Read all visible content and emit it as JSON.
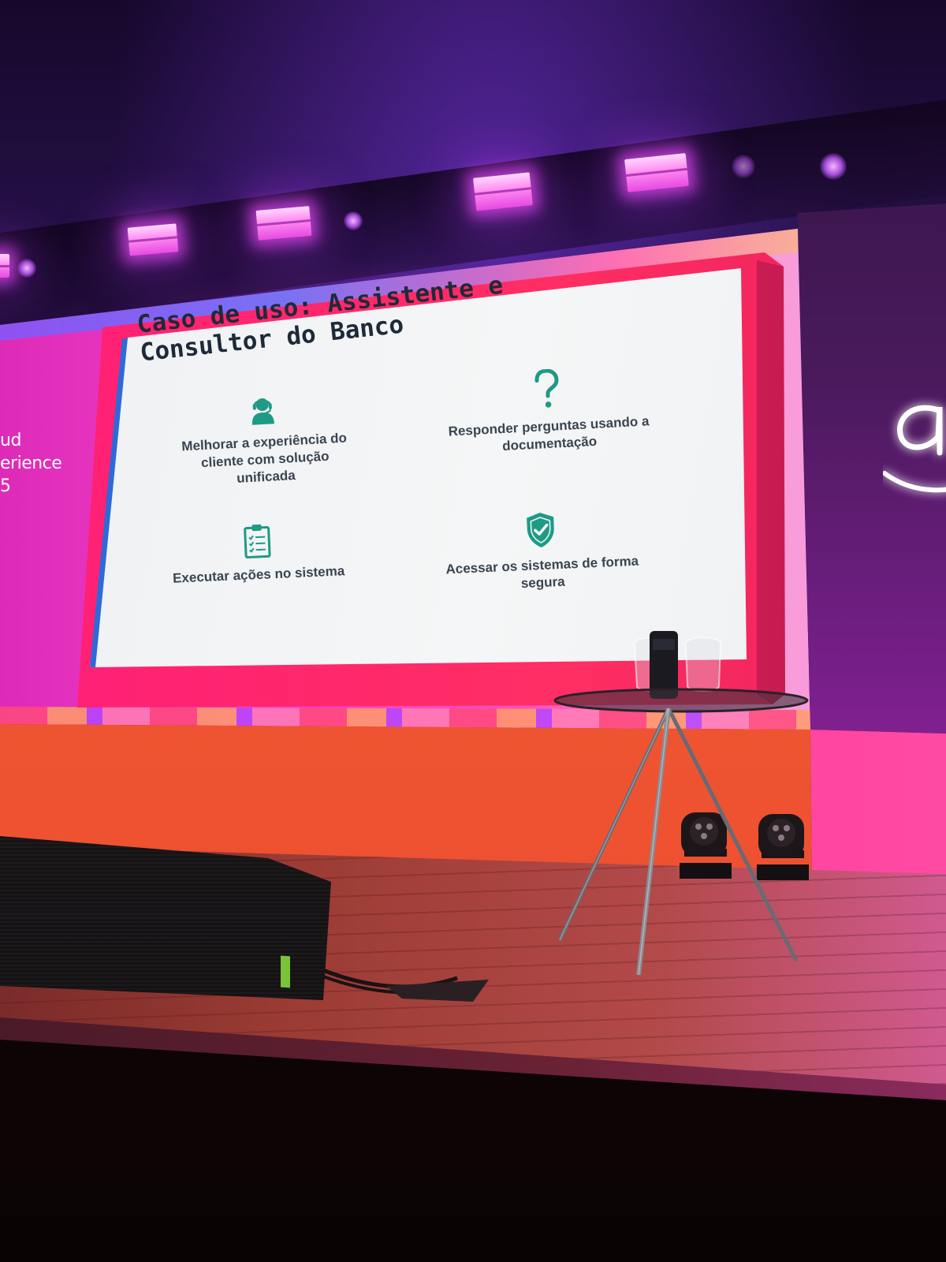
{
  "slide": {
    "title_line1": "Caso de uso: Assistente e",
    "title_line2": "Consultor do Banco",
    "features": [
      {
        "icon": "customer-support-icon",
        "label": "Melhorar a experiência do\ncliente com solução\nunificada"
      },
      {
        "icon": "question-mark-icon",
        "label": "Responder perguntas usando a\ndocumentação"
      },
      {
        "icon": "clipboard-checklist-icon",
        "label": "Executar ações no sistema"
      },
      {
        "icon": "shield-check-icon",
        "label": "Acessar os sistemas de forma\nsegura"
      }
    ],
    "icon_color": "#1e9a85"
  },
  "left_panel": {
    "line1": "ud",
    "line2": "erience",
    "line3": "5"
  },
  "colors": {
    "led_magenta": "#f13fc8",
    "slide_border": "#ff2e63",
    "stage_front": "#f04a3a",
    "light_bar": "#ff8bf1"
  }
}
